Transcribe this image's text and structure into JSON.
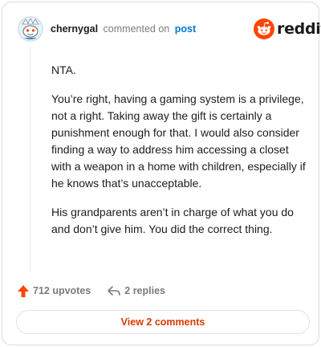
{
  "header": {
    "username": "chernygal",
    "action_text": "commented on",
    "post_link": "post",
    "brand": "reddit"
  },
  "comment": {
    "paragraphs": [
      "NTA.",
      "You’re right, having a gaming system is a privilege, not a right. Taking away the gift is certainly a punishment enough for that. I would also consider finding a way to address him accessing a closet with a weapon in a home with children, especially if he knows that’s unacceptable.",
      "His grandparents aren’t in charge of what you do and don’t give him. You did the correct thing."
    ]
  },
  "footer": {
    "upvotes": "712 upvotes",
    "replies": "2 replies",
    "view_comments": "View 2 comments"
  },
  "colors": {
    "brand_orange": "#ff4500",
    "link_blue": "#0079d3",
    "view_button_text": "#d93a00",
    "muted_text": "#7c7c7c"
  },
  "icons": {
    "avatar": "snoo-avatar",
    "logo": "reddit-snoo-icon",
    "upvote": "upvote-arrow-icon",
    "reply": "reply-arrow-icon"
  }
}
